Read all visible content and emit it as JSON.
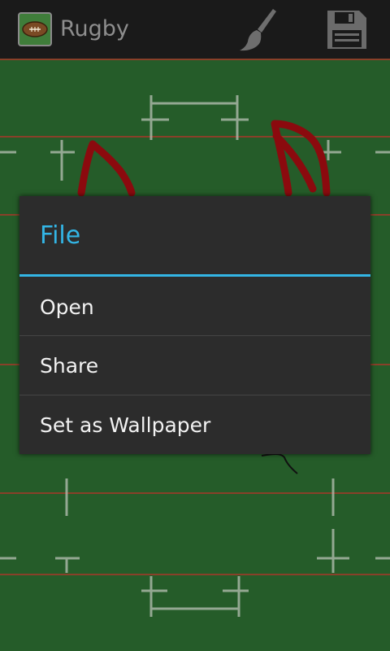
{
  "action_bar": {
    "title": "Rugby",
    "brush_icon": "paintbrush-icon",
    "save_icon": "floppy-disk-icon",
    "app_icon": "rugby-ball-icon"
  },
  "canvas": {
    "field_color": "#255c29",
    "line_color": "#c0c6bc",
    "drawing_red": "#8b0a0e"
  },
  "dialog": {
    "title": "File",
    "accent": "#33b5e5",
    "items": [
      {
        "label": "Open"
      },
      {
        "label": "Share"
      },
      {
        "label": "Set as Wallpaper"
      }
    ]
  }
}
